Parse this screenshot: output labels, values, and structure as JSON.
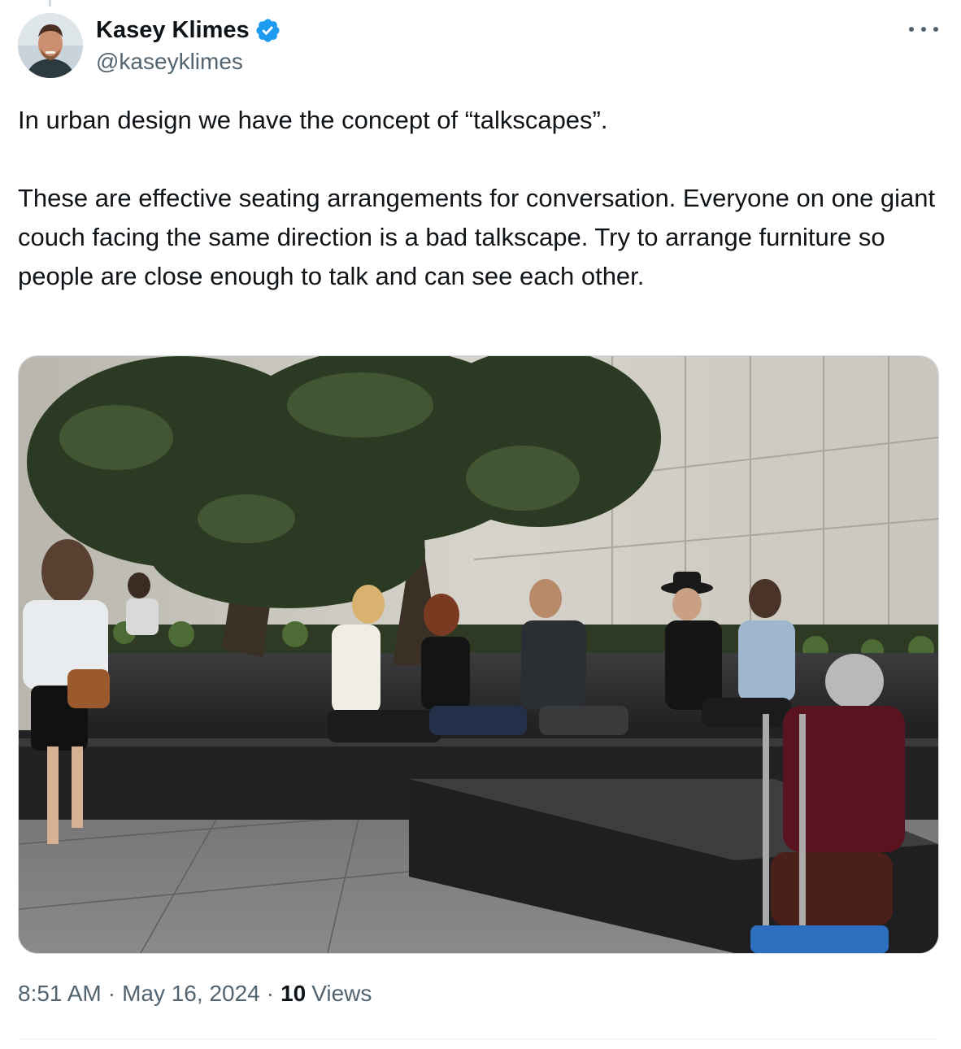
{
  "author": {
    "display_name": "Kasey Klimes",
    "handle": "@kaseyklimes",
    "verified": true
  },
  "tweet": {
    "paragraph_1": "In urban design we have the concept of “talkscapes”.",
    "paragraph_2": "These are effective seating arrangements for conversation. Everyone on one giant couch facing the same direction is a bad talkscape. Try to arrange furniture so people are close enough to talk and can see each other."
  },
  "meta": {
    "time": "8:51 AM",
    "separator": "·",
    "date": "May 16, 2024",
    "views_count": "10",
    "views_label": "Views"
  },
  "colors": {
    "text": "#0f1419",
    "secondary": "#536471",
    "verified_blue": "#1d9bf0",
    "border": "#cfd9de"
  },
  "icons": {
    "more": "more-icon",
    "verified": "verified-badge-icon"
  }
}
